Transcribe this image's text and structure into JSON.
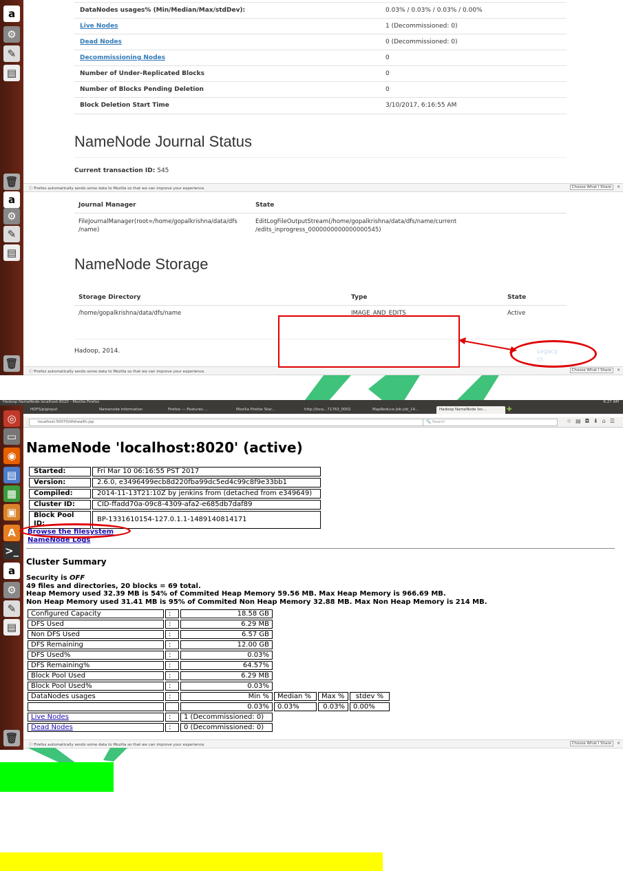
{
  "top": {
    "rows": [
      {
        "label": "DataNodes usages% (Min/Median/Max/stdDev):",
        "value": "0.03% / 0.03% / 0.03% / 0.00%",
        "link": false
      },
      {
        "label": "Live Nodes",
        "value": "1 (Decommissioned: 0)",
        "link": true
      },
      {
        "label": "Dead Nodes",
        "value": "0 (Decommissioned: 0)",
        "link": true
      },
      {
        "label": "Decommissioning Nodes",
        "value": "0",
        "link": true
      },
      {
        "label": "Number of Under-Replicated Blocks",
        "value": "0",
        "link": false
      },
      {
        "label": "Number of Blocks Pending Deletion",
        "value": "0",
        "link": false
      },
      {
        "label": "Block Deletion Start Time",
        "value": "3/10/2017, 6:16:55 AM",
        "link": false
      }
    ],
    "journal_title": "NameNode Journal Status",
    "current_txn_label": "Current transaction ID:",
    "current_txn_value": "545",
    "journal_headers": {
      "manager": "Journal Manager",
      "state": "State"
    },
    "journal_manager": "FileJournalManager(root=/home/gopalkrishna/data/dfs /name)",
    "journal_state": "EditLogFileOutputStream(/home/gopalkrishna/data/dfs/name/current /edits_inprogress_0000000000000000545)",
    "storage_title": "NameNode Storage",
    "storage_headers": {
      "dir": "Storage Directory",
      "type": "Type",
      "state": "State"
    },
    "storage_dir": "/home/gopalkrishna/data/dfs/name",
    "storage_type": "IMAGE_AND_EDITS",
    "storage_state": "Active",
    "footer": "Hadoop, 2014.",
    "legacy_ui": "Legacy UI",
    "notify_msg": "Firefox automatically sends some data to Mozilla so that we can improve your experience.",
    "notify_btn": "Choose What I Share",
    "notify_close": "×"
  },
  "bottom": {
    "window_title": "Hadoop NameNode localhost:8020 - Mozilla Firefox",
    "clock": "6:27 AM",
    "tabs": [
      "HDFS/piginput",
      "Namenode information",
      "Firefox — Features ...",
      "Mozilla Firefox Star...",
      "http://loca...71763_0002",
      "MapReduce Job job_14...",
      "Hadoop NameNode loc..."
    ],
    "url": "localhost:50070/dfshealth.jsp",
    "search_placeholder": "Search",
    "title": "NameNode 'localhost:8020' (active)",
    "info": [
      {
        "k": "Started:",
        "v": "Fri Mar 10 06:16:55 PST 2017"
      },
      {
        "k": "Version:",
        "v": "2.6.0, e3496499ecb8d220fba99dc5ed4c99c8f9e33bb1"
      },
      {
        "k": "Compiled:",
        "v": "2014-11-13T21:10Z by jenkins from (detached from e349649)"
      },
      {
        "k": "Cluster ID:",
        "v": "CID-ffadd70a-09c8-4309-afa2-e685db7daf89"
      },
      {
        "k": "Block Pool ID:",
        "v": "BP-1331610154-127.0.1.1-1489140814171"
      }
    ],
    "browse_link": "Browse the filesystem",
    "logs_link": "NameNode Logs",
    "cluster_summary": "Cluster Summary",
    "security_prefix": "Security is",
    "security_state": "OFF",
    "files_line": "49 files and directories, 20 blocks = 69 total.",
    "heap_line": "Heap Memory used 32.39 MB is 54% of Commited Heap Memory 59.56 MB. Max Heap Memory is 966.69 MB.",
    "nonheap_line": "Non Heap Memory used 31.41 MB is 95% of Commited Non Heap Memory 32.88 MB. Max Non Heap Memory is 214 MB.",
    "capacity": [
      {
        "k": "Configured Capacity",
        "v": "18.58 GB"
      },
      {
        "k": "DFS Used",
        "v": "6.29 MB"
      },
      {
        "k": "Non DFS Used",
        "v": "6.57 GB"
      },
      {
        "k": "DFS Remaining",
        "v": "12.00 GB"
      },
      {
        "k": "DFS Used%",
        "v": "0.03%"
      },
      {
        "k": "DFS Remaining%",
        "v": "64.57%"
      },
      {
        "k": "Block Pool Used",
        "v": "6.29 MB"
      },
      {
        "k": "Block Pool Used%",
        "v": "0.03%"
      }
    ],
    "usage_label": "DataNodes usages",
    "usage_headers": [
      "Min %",
      "Median %",
      "Max %",
      "stdev %"
    ],
    "usage_values": [
      "0.03%",
      "0.03%",
      "0.03%",
      "0.00%"
    ],
    "sep": ":",
    "live_nodes": "Live Nodes",
    "live_value": "1 (Decommissioned: 0)",
    "dead_nodes": "Dead Nodes",
    "dead_value": "0 (Decommissioned: 0)",
    "notify_msg": "Firefox automatically sends some data to Mozilla so that we can improve your experience.",
    "notify_btn": "Choose What I Share",
    "notify_close": "×"
  },
  "colors": {
    "annotation_red": "#e00000",
    "annotation_green": "#3fc27a",
    "highlight_green": "#00ff00",
    "highlight_yellow": "#ffff00",
    "launcher": "#5a1f12"
  }
}
